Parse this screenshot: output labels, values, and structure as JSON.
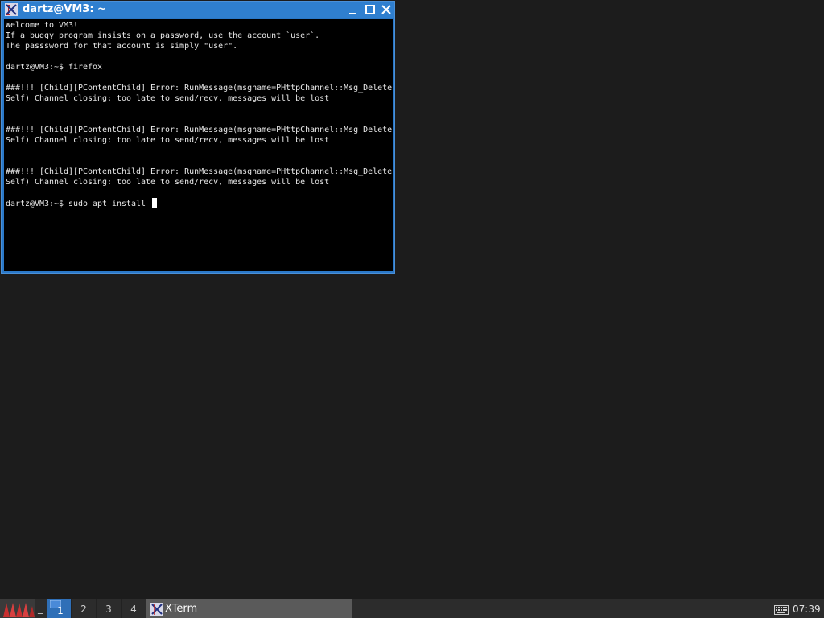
{
  "window": {
    "title": "dartz@VM3: ~",
    "icon": "xterm-icon"
  },
  "terminal": {
    "lines": [
      "Welcome to VM3!",
      "If a buggy program insists on a password, use the account `user`.",
      "The passsword for that account is simply \"user\".",
      "",
      "dartz@VM3:~$ firefox",
      "",
      "###!!! [Child][PContentChild] Error: RunMessage(msgname=PHttpChannel::Msg_Delete",
      "Self) Channel closing: too late to send/recv, messages will be lost",
      "",
      "",
      "###!!! [Child][PContentChild] Error: RunMessage(msgname=PHttpChannel::Msg_Delete",
      "Self) Channel closing: too late to send/recv, messages will be lost",
      "",
      "",
      "###!!! [Child][PContentChild] Error: RunMessage(msgname=PHttpChannel::Msg_Delete",
      "Self) Channel closing: too late to send/recv, messages will be lost",
      "",
      "dartz@VM3:~$ sudo apt install "
    ]
  },
  "taskbar": {
    "show_desktop": "_",
    "workspaces": [
      "1",
      "2",
      "3",
      "4"
    ],
    "active_workspace": "1",
    "task_label": "XTerm",
    "clock": "07:39"
  },
  "colors": {
    "window_border": "#2a78c8",
    "titlebar": "#2f7fcf",
    "terminal_bg": "#000000",
    "terminal_fg": "#e8e8e8",
    "desktop": "#1c1c1c",
    "taskbar": "#2c2c2c",
    "active_workspace": "#2f6fb7"
  }
}
